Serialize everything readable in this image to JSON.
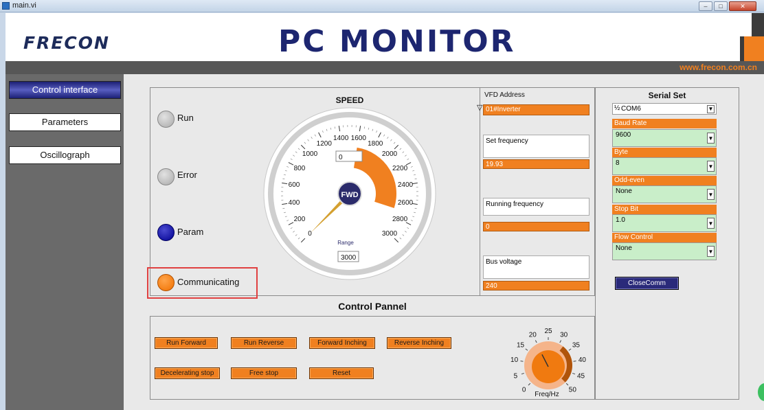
{
  "window": {
    "title": "main.vi",
    "min": "–",
    "max": "□",
    "close": "✕"
  },
  "header": {
    "logo": "FRECON",
    "title": "PC MONITOR",
    "url": "www.frecon.com.cn"
  },
  "sidebar": {
    "items": [
      {
        "label": "Control interface",
        "active": true
      },
      {
        "label": "Parameters",
        "active": false
      },
      {
        "label": "Oscillograph",
        "active": false
      }
    ]
  },
  "indicators": [
    {
      "label": "Run",
      "state": "grey"
    },
    {
      "label": "Error",
      "state": "grey"
    },
    {
      "label": "Param",
      "state": "blue"
    },
    {
      "label": "Communicating",
      "state": "orange"
    }
  ],
  "speed": {
    "title": "SPEED",
    "value_box": "0",
    "hub": "FWD",
    "ticks": [
      "0",
      "200",
      "400",
      "600",
      "800",
      "1000",
      "1200",
      "1400",
      "1600",
      "1800",
      "2000",
      "2200",
      "2400",
      "2600",
      "2800",
      "3000"
    ],
    "range_label": "Range",
    "range_value": "3000",
    "range_max": 3000,
    "needle_value": 0,
    "arc_start": 1600,
    "arc_end": 2700,
    "needle_color": "#d4a030",
    "arc_color": "#f08020"
  },
  "vfd": {
    "address_label": "VFD Address",
    "address_value": "01#Inverter",
    "set_freq_label": "Set frequency",
    "set_freq_value": "19.93",
    "run_freq_label": "Running frequency",
    "run_freq_value": "0",
    "bus_voltage_label": "Bus voltage",
    "bus_voltage_value": "240"
  },
  "serial": {
    "title": "Serial Set",
    "port": "COM6",
    "baud_label": "Baud Rate",
    "baud_value": "9600",
    "byte_label": "Byte",
    "byte_value": "8",
    "parity_label": "Odd-even",
    "parity_value": "None",
    "stop_label": "Stop Bit",
    "stop_value": "1.0",
    "flow_label": "Flow Control",
    "flow_value": "None",
    "close_button": "CloseComm"
  },
  "control": {
    "title": "Control Pannel",
    "buttons": [
      "Run Forward",
      "Run Reverse",
      "Forward Inching",
      "Reverse Inching",
      "Decelerating stop",
      "Free stop",
      "Reset"
    ]
  },
  "freq_knob": {
    "label": "Freq/Hz",
    "ticks": [
      "0",
      "5",
      "10",
      "15",
      "20",
      "25",
      "30",
      "35",
      "40",
      "45",
      "50"
    ],
    "max": 50,
    "value": 20
  },
  "colors": {
    "accent": "#f08020",
    "brand": "#1d2670"
  }
}
